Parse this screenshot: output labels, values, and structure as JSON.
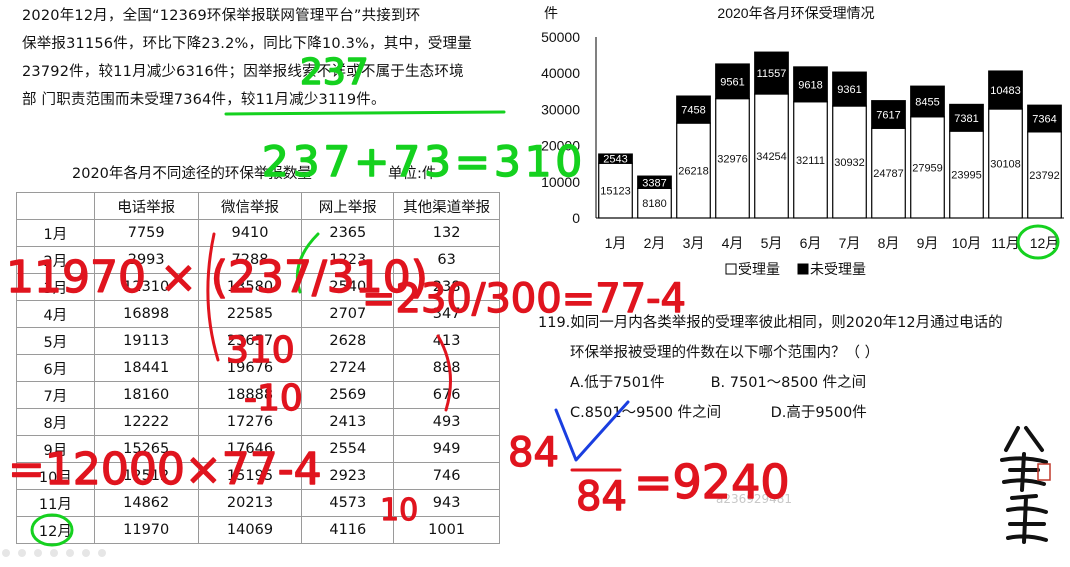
{
  "paragraph": {
    "lines": [
      "2020年12月，全国“12369环保举报联网管理平台”共接到环",
      "保举报31156件，环比下降23.2%，同比下降10.3%，其中，受理量",
      "23792件，较11月减少6316件；因举报线索不详或不属于生态环境",
      "部 门职责范围而未受理7364件，较11月减少3119件。"
    ]
  },
  "table": {
    "title": "2020年各月不同途径的环保举报数量",
    "unit": "单位:件",
    "headers": [
      "",
      "电话举报",
      "微信举报",
      "网上举报",
      "其他渠道举报"
    ],
    "rows": [
      [
        "1月",
        "7759",
        "9410",
        "2365",
        "132"
      ],
      [
        "2月",
        "2993",
        "7288",
        "1223",
        "63"
      ],
      [
        "3月",
        "12310",
        "13580",
        "2540",
        "238"
      ],
      [
        "4月",
        "16898",
        "22585",
        "2707",
        "347"
      ],
      [
        "5月",
        "19113",
        "23657",
        "2628",
        "413"
      ],
      [
        "6月",
        "18441",
        "19676",
        "2724",
        "888"
      ],
      [
        "7月",
        "18160",
        "18888",
        "2569",
        "676"
      ],
      [
        "8月",
        "12222",
        "17276",
        "2413",
        "493"
      ],
      [
        "9月",
        "15265",
        "17646",
        "2554",
        "949"
      ],
      [
        "10月",
        "12512",
        "15195",
        "2923",
        "746"
      ],
      [
        "11月",
        "14862",
        "20213",
        "4573",
        "943"
      ],
      [
        "12月",
        "11970",
        "14069",
        "4116",
        "1001"
      ]
    ]
  },
  "chart_data": {
    "type": "bar",
    "stacked": true,
    "title": "2020年各月环保受理情况",
    "ylabel": "件",
    "ylim": [
      0,
      50000
    ],
    "yticks": [
      "0",
      "10000",
      "20000",
      "30000",
      "40000",
      "50000"
    ],
    "categories": [
      "1月",
      "2月",
      "3月",
      "4月",
      "5月",
      "6月",
      "7月",
      "8月",
      "9月",
      "10月",
      "11月",
      "12月"
    ],
    "series": [
      {
        "name": "受理量",
        "color": "#ffffff",
        "values": [
          15123,
          8180,
          26218,
          32976,
          34254,
          32111,
          30932,
          24787,
          27959,
          23995,
          30108,
          23792
        ]
      },
      {
        "name": "未受理量",
        "color": "#000000",
        "values": [
          2543,
          3387,
          7458,
          9561,
          11557,
          9618,
          9361,
          7617,
          8455,
          7381,
          10483,
          7364
        ]
      }
    ],
    "legend_position": "bottom",
    "grid": false
  },
  "question": {
    "stem_line1": "119.如同一月内各类举报的受理率彼此相同，则2020年12月通过电话的",
    "stem_line2": "环保举报被受理的件数在以下哪个范围内？（  ）",
    "options": [
      "A.低于7501件",
      "B. 7501～8500 件之间",
      "C.8501～9500 件之间",
      "D.高于9500件"
    ]
  },
  "watermark": "a236929481",
  "logo_text": "公考思维",
  "annotations": {
    "top_fraction_num": "237",
    "top_equation": "237+73=310",
    "left_expression": "11970 × (237/310)",
    "right_result": "=230/300=77-4",
    "bottom_expression": "=12000×77-4",
    "fraction_denominator": "310",
    "minus_ten": "-10",
    "result_top": "84",
    "result_bottom": "84",
    "result_value": "=9240",
    "fraction_bottom_ten": "10"
  },
  "colors": {
    "ink_green": "#15d11f",
    "ink_red": "#e0141e",
    "ink_blue": "#1a3ee0"
  }
}
